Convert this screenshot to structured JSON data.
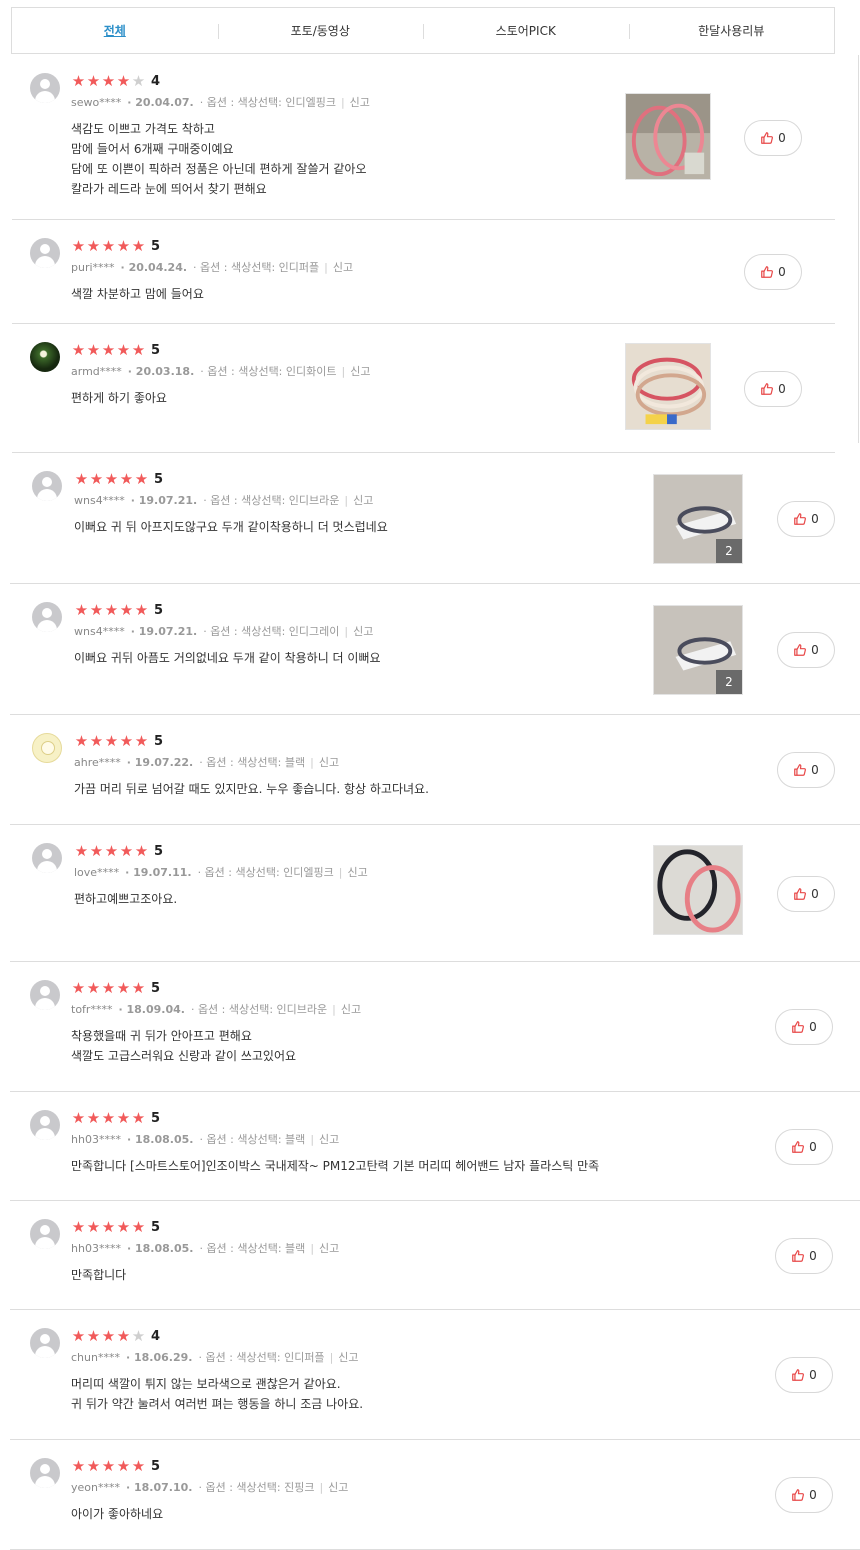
{
  "tabs": [
    "전체",
    "포토/동영상",
    "스토어PICK",
    "한달사용리뷰"
  ],
  "reviews": [
    {
      "user": "sewo****",
      "date": "20.04.07.",
      "option": "옵션 : 색상선택: 인디엘핑크",
      "report": "신고",
      "rating": 4,
      "score": "4",
      "likes": "0",
      "lines": [
        "색감도 이쁘고 가격도 착하고",
        "맘에 들어서 6개째 구매중이예요",
        "담에 또 이쁜이 픽하러 정품은 아닌데 편하게 잘쓸거 같아오",
        "칼라가 레드라 눈에 띄어서 찾기 편해요"
      ],
      "photo": true
    },
    {
      "user": "puri****",
      "date": "20.04.24.",
      "option": "옵션 : 색상선택: 인디퍼플",
      "report": "신고",
      "rating": 5,
      "score": "5",
      "likes": "0",
      "lines": [
        "색깔 차분하고 맘에 들어요"
      ],
      "photo": false
    },
    {
      "user": "armd****",
      "date": "20.03.18.",
      "option": "옵션 : 색상선택: 인디화이트",
      "report": "신고",
      "rating": 5,
      "score": "5",
      "likes": "0",
      "lines": [
        "편하게 하기 좋아요"
      ],
      "photo": true
    },
    {
      "user": "wns4****",
      "date": "19.07.21.",
      "option": "옵션 : 색상선택: 인디브라운",
      "report": "신고",
      "rating": 5,
      "score": "5",
      "likes": "0",
      "lines": [
        "이뻐요 귀 뒤 아프지도않구요 두개 같이착용하니 더 멋스럽네요"
      ],
      "photo": true,
      "photo_count": "2"
    },
    {
      "user": "wns4****",
      "date": "19.07.21.",
      "option": "옵션 : 색상선택: 인디그레이",
      "report": "신고",
      "rating": 5,
      "score": "5",
      "likes": "0",
      "lines": [
        "이뻐요 귀뒤 아픔도 거의없네요 두개 같이 착용하니 더 이뻐요"
      ],
      "photo": true,
      "photo_count": "2"
    },
    {
      "user": "ahre****",
      "date": "19.07.22.",
      "option": "옵션 : 색상선택: 블랙",
      "report": "신고",
      "rating": 5,
      "score": "5",
      "likes": "0",
      "lines": [
        "가끔 머리 뒤로 넘어갈 때도 있지만요. 누우 좋습니다. 항상 하고다녀요."
      ],
      "photo": false
    },
    {
      "user": "love****",
      "date": "19.07.11.",
      "option": "옵션 : 색상선택: 인디엘핑크",
      "report": "신고",
      "rating": 5,
      "score": "5",
      "likes": "0",
      "lines": [
        "편하고예쁘고조아요."
      ],
      "photo": true
    },
    {
      "user": "tofr****",
      "date": "18.09.04.",
      "option": "옵션 : 색상선택: 인디브라운",
      "report": "신고",
      "rating": 5,
      "score": "5",
      "likes": "0",
      "lines": [
        "착용했을때 귀 뒤가 안아프고 편해요",
        "색깔도 고급스러워요 신랑과 같이 쓰고있어요"
      ],
      "photo": false
    },
    {
      "user": "hh03****",
      "date": "18.08.05.",
      "option": "옵션 : 색상선택: 블랙",
      "report": "신고",
      "rating": 5,
      "score": "5",
      "likes": "0",
      "lines": [
        "만족합니다 [스마트스토어]인조이박스 국내제작~ PM12고탄력 기본 머리띠 헤어밴드 남자 플라스틱 만족"
      ],
      "photo": false
    },
    {
      "user": "hh03****",
      "date": "18.08.05.",
      "option": "옵션 : 색상선택: 블랙",
      "report": "신고",
      "rating": 5,
      "score": "5",
      "likes": "0",
      "lines": [
        "만족합니다"
      ],
      "photo": false
    },
    {
      "user": "chun****",
      "date": "18.06.29.",
      "option": "옵션 : 색상선택: 인디퍼플",
      "report": "신고",
      "rating": 4,
      "score": "4",
      "likes": "0",
      "lines": [
        "머리띠 색깔이 튀지 않는 보라색으로 괜찮은거 같아요.",
        "귀 뒤가 약간 눌려서 여러번 펴는 행동을 하니 조금 나아요."
      ],
      "photo": false
    },
    {
      "user": "yeon****",
      "date": "18.07.10.",
      "option": "옵션 : 색상선택: 진핑크",
      "report": "신고",
      "rating": 5,
      "score": "5",
      "likes": "0",
      "lines": [
        "아이가 좋아하네요"
      ],
      "photo": false
    }
  ]
}
